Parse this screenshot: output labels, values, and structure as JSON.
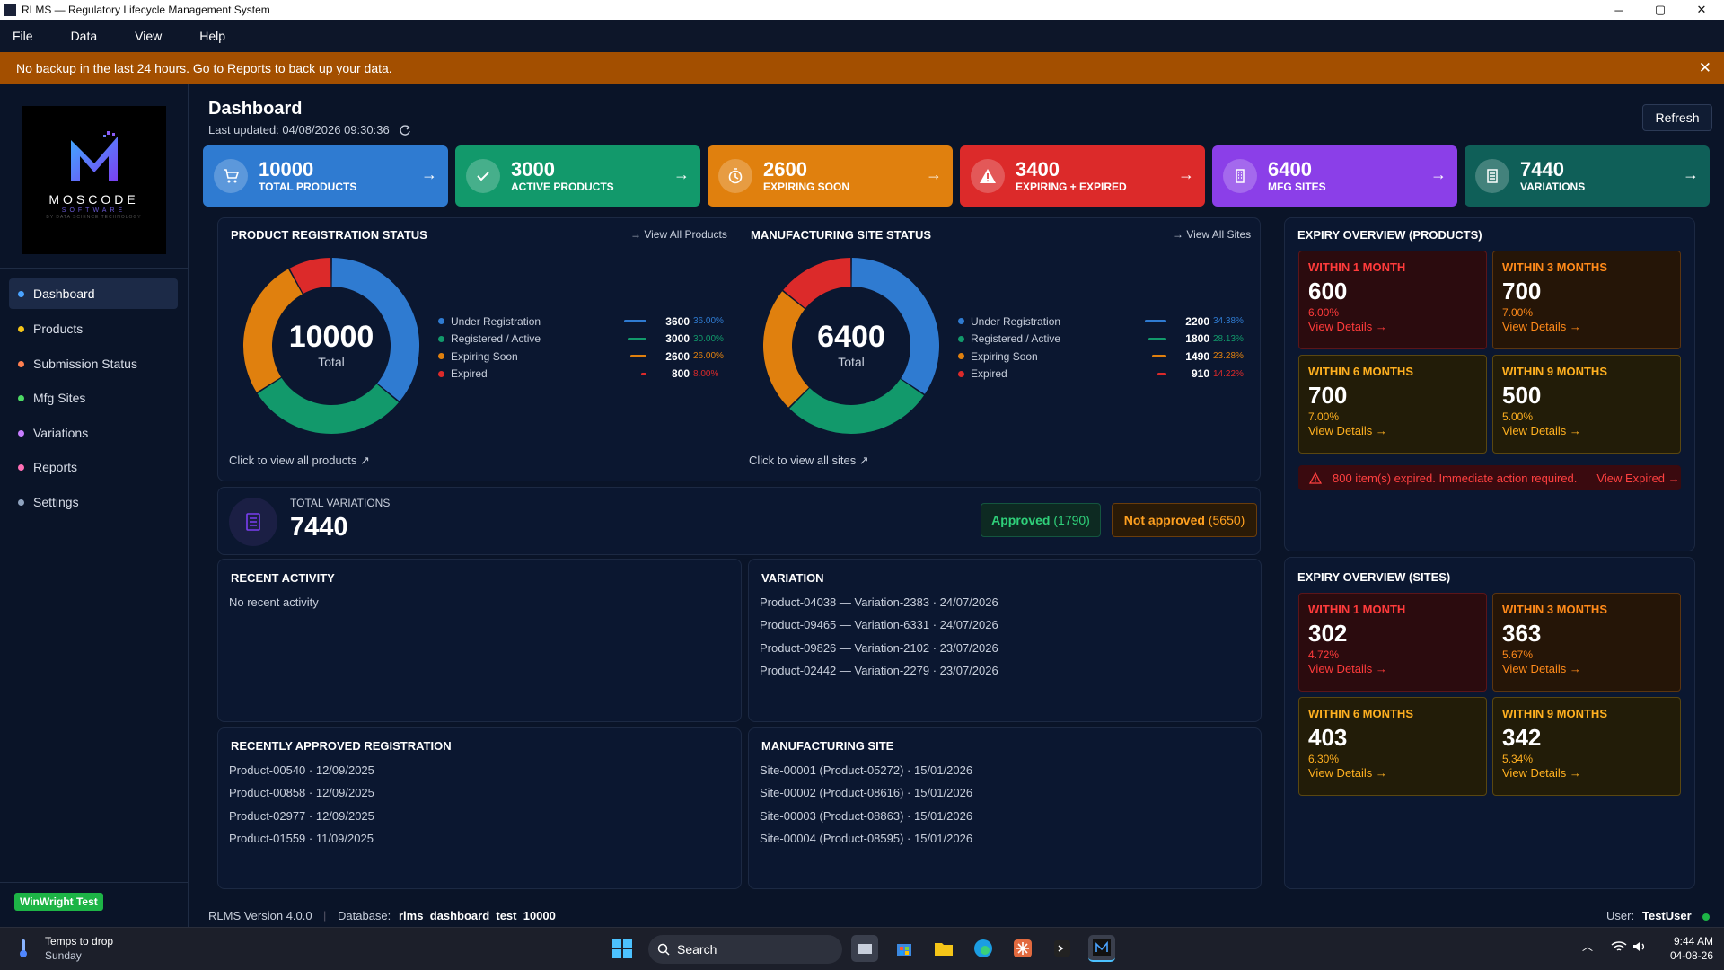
{
  "window": {
    "title": "RLMS — Regulatory Lifecycle Management System",
    "min_glyph": "─",
    "max_glyph": "▢",
    "close_glyph": "✕"
  },
  "menu": [
    "File",
    "Data",
    "View",
    "Help"
  ],
  "banner": {
    "text": "No backup in the last 24 hours. Go to Reports to back up your data.",
    "close_glyph": "✕"
  },
  "logo": {
    "name": "MOSCODE",
    "sub": "SOFTWARE",
    "tag": "BY DATA SCIENCE TECHNOLOGY"
  },
  "sidebar": {
    "items": [
      {
        "label": "Dashboard",
        "color": "#4aa3ff"
      },
      {
        "label": "Products",
        "color": "#f5c518"
      },
      {
        "label": "Submission Status",
        "color": "#ff7f50"
      },
      {
        "label": "Mfg Sites",
        "color": "#4cd964"
      },
      {
        "label": "Variations",
        "color": "#c77dff"
      },
      {
        "label": "Reports",
        "color": "#ff6fb5"
      },
      {
        "label": "Settings",
        "color": "#8fa3bf"
      }
    ],
    "badge": "WinWright Test"
  },
  "header": {
    "title": "Dashboard",
    "last_updated": "Last updated: 04/08/2026 09:30:36",
    "refresh": "Refresh"
  },
  "kpis": [
    {
      "value": "10000",
      "label": "TOTAL PRODUCTS",
      "color": "#2f7bd1",
      "icon": "cart-icon"
    },
    {
      "value": "3000",
      "label": "ACTIVE PRODUCTS",
      "color": "#12996b",
      "icon": "check-icon"
    },
    {
      "value": "2600",
      "label": "EXPIRING SOON",
      "color": "#e0800e",
      "icon": "clock-icon"
    },
    {
      "value": "3400",
      "label": "EXPIRING + EXPIRED",
      "color": "#dc2a2a",
      "icon": "warning-icon"
    },
    {
      "value": "6400",
      "label": "MFG SITES",
      "color": "#8b3fe8",
      "icon": "building-icon"
    },
    {
      "value": "7440",
      "label": "VARIATIONS",
      "color": "#0f5f58",
      "icon": "document-icon"
    }
  ],
  "product_status": {
    "title": "PRODUCT REGISTRATION STATUS",
    "link": "→ View All Products",
    "center_value": "10000",
    "center_label": "Total",
    "footer": "Click to view all products ↗",
    "rows": [
      {
        "label": "Under Registration",
        "value": "3600",
        "pct": "36.00%",
        "frac": 0.36,
        "color": "#2f7bd1"
      },
      {
        "label": "Registered / Active",
        "value": "3000",
        "pct": "30.00%",
        "frac": 0.3,
        "color": "#12996b"
      },
      {
        "label": "Expiring Soon",
        "value": "2600",
        "pct": "26.00%",
        "frac": 0.26,
        "color": "#e0800e"
      },
      {
        "label": "Expired",
        "value": "800",
        "pct": "8.00%",
        "frac": 0.08,
        "color": "#dc2a2a"
      }
    ]
  },
  "site_status": {
    "title": "MANUFACTURING SITE STATUS",
    "link": "→ View All Sites",
    "center_value": "6400",
    "center_label": "Total",
    "footer": "Click to view all sites ↗",
    "rows": [
      {
        "label": "Under Registration",
        "value": "2200",
        "pct": "34.38%",
        "frac": 0.3438,
        "color": "#2f7bd1"
      },
      {
        "label": "Registered / Active",
        "value": "1800",
        "pct": "28.13%",
        "frac": 0.2813,
        "color": "#12996b"
      },
      {
        "label": "Expiring Soon",
        "value": "1490",
        "pct": "23.28%",
        "frac": 0.2328,
        "color": "#e0800e"
      },
      {
        "label": "Expired",
        "value": "910",
        "pct": "14.22%",
        "frac": 0.1422,
        "color": "#dc2a2a"
      }
    ]
  },
  "variations": {
    "label": "TOTAL VARIATIONS",
    "value": "7440",
    "approved_label": "Approved",
    "approved_count": "(1790)",
    "not_approved_label": "Not approved",
    "not_approved_count": "(5650)"
  },
  "recent_activity": {
    "title": "RECENT ACTIVITY",
    "empty": "No recent activity"
  },
  "variation_list": {
    "title": "VARIATION",
    "items": [
      "Product-04038 — Variation-2383 · 24/07/2026",
      "Product-09465 — Variation-6331 · 24/07/2026",
      "Product-09826 — Variation-2102 · 23/07/2026",
      "Product-02442 — Variation-2279 · 23/07/2026"
    ]
  },
  "approved_list": {
    "title": "RECENTLY APPROVED REGISTRATION",
    "items": [
      "Product-00540 · 12/09/2025",
      "Product-00858 · 12/09/2025",
      "Product-02977 · 12/09/2025",
      "Product-01559 · 11/09/2025"
    ]
  },
  "site_list": {
    "title": "MANUFACTURING SITE",
    "items": [
      "Site-00001 (Product-05272) · 15/01/2026",
      "Site-00002 (Product-08616) · 15/01/2026",
      "Site-00003 (Product-08863) · 15/01/2026",
      "Site-00004 (Product-08595) · 15/01/2026"
    ]
  },
  "expiry_products": {
    "title": "EXPIRY OVERVIEW (PRODUCTS)",
    "cards": [
      {
        "title": "WITHIN 1 MONTH",
        "value": "600",
        "pct": "6.00%",
        "link": "View Details →"
      },
      {
        "title": "WITHIN 3 MONTHS",
        "value": "700",
        "pct": "7.00%",
        "link": "View Details →"
      },
      {
        "title": "WITHIN 6 MONTHS",
        "value": "700",
        "pct": "7.00%",
        "link": "View Details →"
      },
      {
        "title": "WITHIN 9 MONTHS",
        "value": "500",
        "pct": "5.00%",
        "link": "View Details →"
      }
    ],
    "alert": "800 item(s) expired. Immediate action required.",
    "alert_link": "View Expired →"
  },
  "expiry_sites": {
    "title": "EXPIRY OVERVIEW (SITES)",
    "cards": [
      {
        "title": "WITHIN 1 MONTH",
        "value": "302",
        "pct": "4.72%",
        "link": "View Details →"
      },
      {
        "title": "WITHIN 3 MONTHS",
        "value": "363",
        "pct": "5.67%",
        "link": "View Details →"
      },
      {
        "title": "WITHIN 6 MONTHS",
        "value": "403",
        "pct": "6.30%",
        "link": "View Details →"
      },
      {
        "title": "WITHIN 9 MONTHS",
        "value": "342",
        "pct": "5.34%",
        "link": "View Details →"
      }
    ]
  },
  "statusbar": {
    "version": "RLMS Version 4.0.0",
    "sep": "|",
    "db_label": "Database:",
    "db_value": "rlms_dashboard_test_10000",
    "user_label": "User:",
    "user_value": "TestUser"
  },
  "taskbar": {
    "weather_title": "Temps to drop",
    "weather_sub": "Sunday",
    "search": "Search",
    "time": "9:44 AM",
    "date": "04-08-26"
  }
}
